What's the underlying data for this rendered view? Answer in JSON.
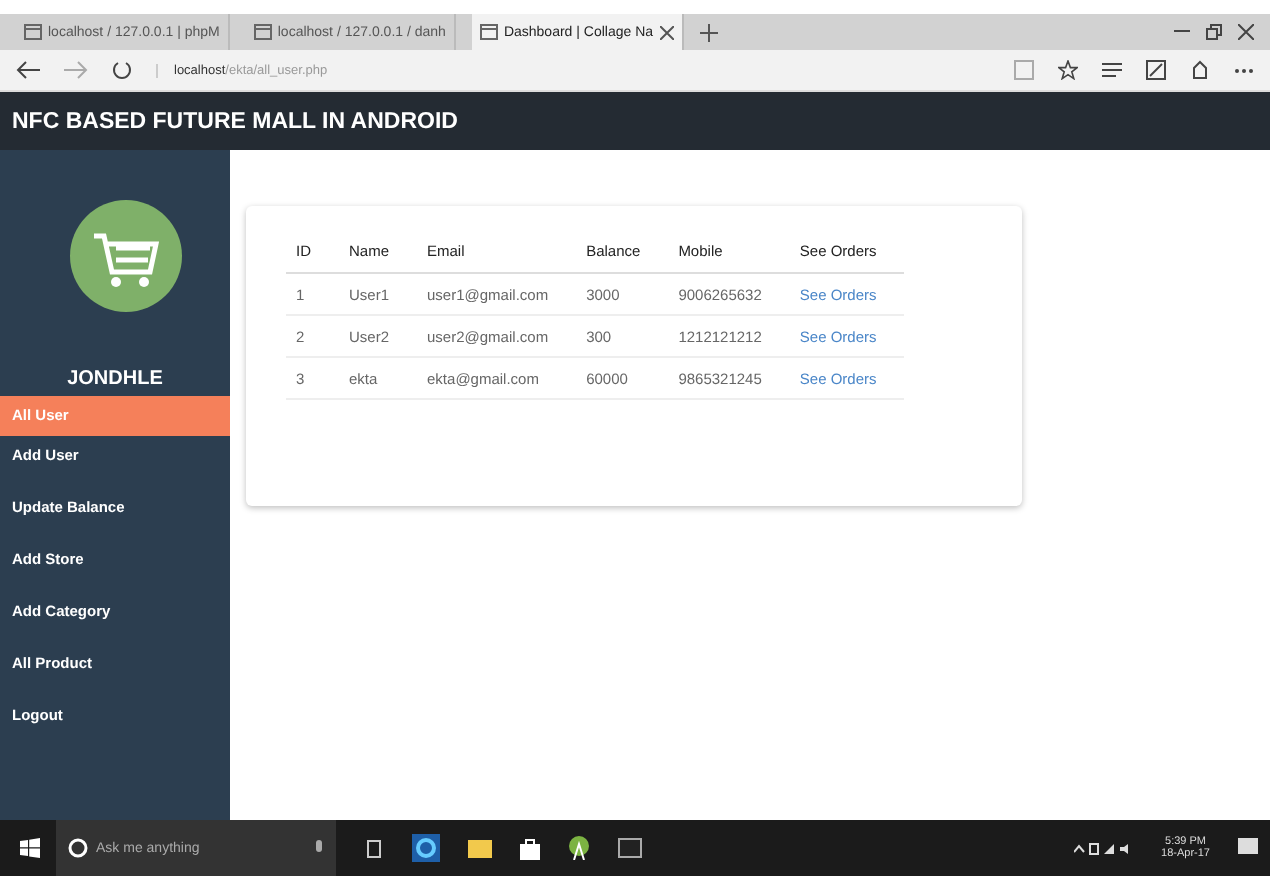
{
  "browser": {
    "tabs": [
      {
        "label": "localhost / 127.0.0.1 | phpM",
        "selected": false
      },
      {
        "label": "localhost / 127.0.0.1 / danh",
        "selected": false
      },
      {
        "label": "Dashboard | Collage Na",
        "selected": true
      }
    ],
    "url_host": "localhost",
    "url_path": "/ekta/all_user.php"
  },
  "app": {
    "title": "NFC BASED FUTURE MALL IN ANDROID"
  },
  "sidebar": {
    "user": "JONDHLE",
    "items": [
      {
        "label": "All User",
        "selected": true
      },
      {
        "label": "Add User",
        "selected": false
      },
      {
        "label": "Update Balance",
        "selected": false
      },
      {
        "label": "Add Store",
        "selected": false
      },
      {
        "label": "Add Category",
        "selected": false
      },
      {
        "label": "All Product",
        "selected": false
      },
      {
        "label": "Logout",
        "selected": false
      }
    ]
  },
  "table": {
    "columns": [
      "ID",
      "Name",
      "Email",
      "Balance",
      "Mobile",
      "See Orders"
    ],
    "rows": [
      [
        "1",
        "User1",
        "user1@gmail.com",
        "3000",
        "9006265632",
        "See Orders"
      ],
      [
        "2",
        "User2",
        "user2@gmail.com",
        "300",
        "1212121212",
        "See Orders"
      ],
      [
        "3",
        "ekta",
        "ekta@gmail.com",
        "60000",
        "9865321245",
        "See Orders"
      ]
    ]
  },
  "taskbar": {
    "search_placeholder": "Ask me anything",
    "time": "5:39 PM",
    "date": "18-Apr-17"
  }
}
